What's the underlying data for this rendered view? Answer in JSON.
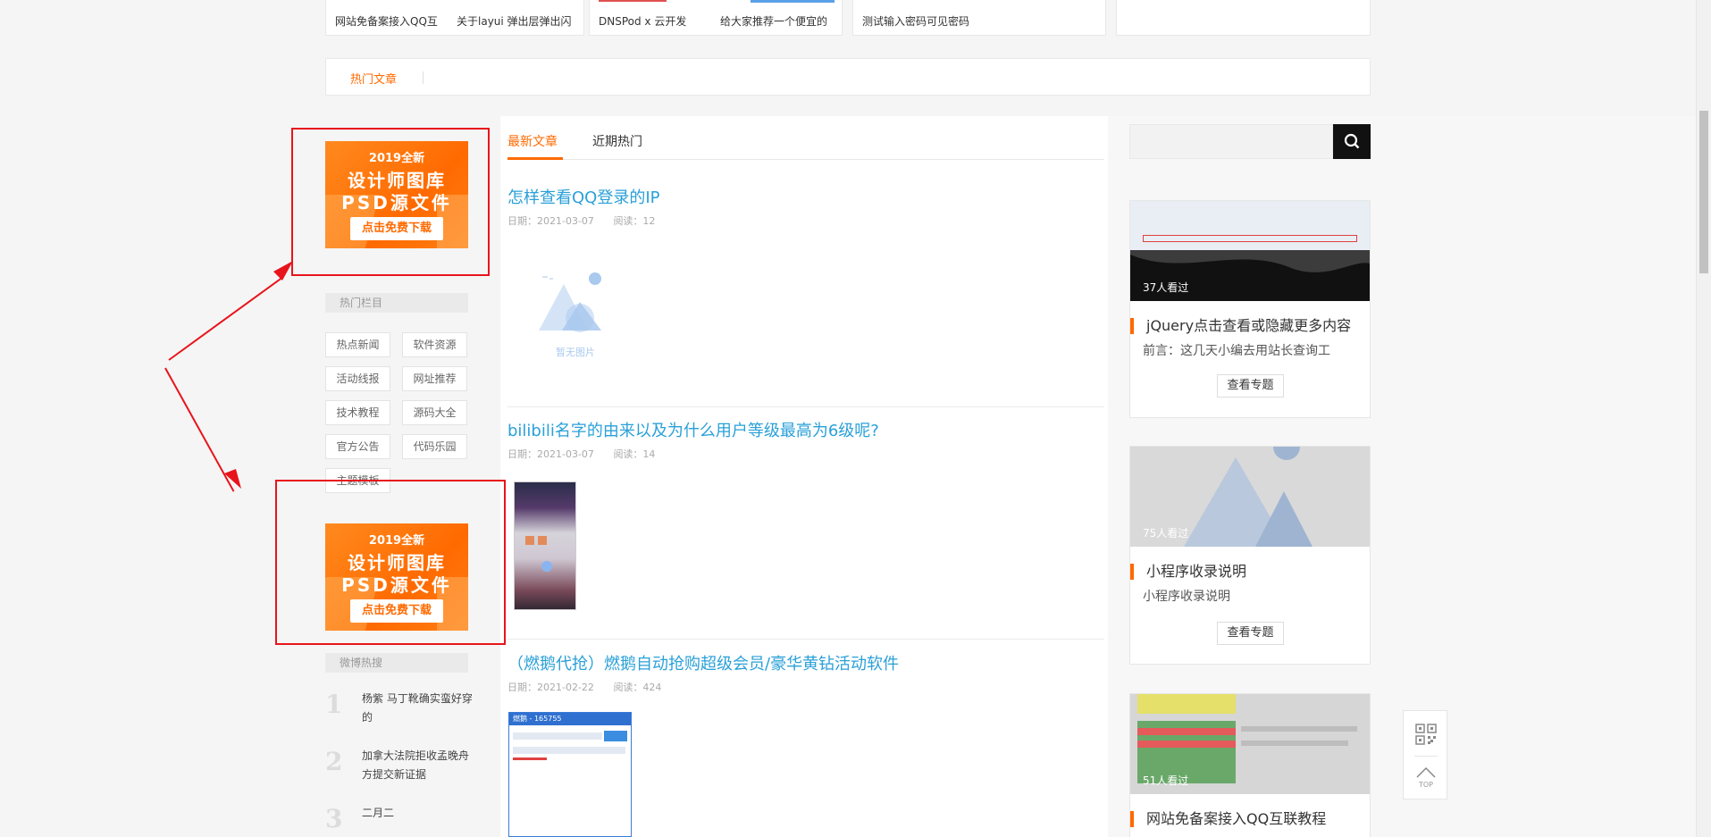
{
  "top_cards": [
    {
      "items": [
        "网站免备案接入QQ互",
        "关于layui 弹出层弹出闪"
      ]
    },
    {
      "items": [
        "DNSPod x 云开发",
        "给大家推荐一个便宜的"
      ]
    },
    {
      "items": [
        "测试输入密码可见密码"
      ]
    },
    {
      "items": []
    }
  ],
  "hot_tab": {
    "label": "热门文章"
  },
  "banner": {
    "line1": "2019全新",
    "line2": "设计师图库",
    "line3": "PSD源文件",
    "button": "点击免费下载"
  },
  "sidebar": {
    "hot_columns_title": "热门栏目",
    "categories": [
      "热点新闻",
      "软件资源",
      "活动线报",
      "网址推荐",
      "技术教程",
      "源码大全",
      "官方公告",
      "代码乐园",
      "主题模板"
    ],
    "weibo_title": "微博热搜",
    "weibo": [
      {
        "num": "1",
        "text": "杨紫 马丁靴确实蛮好穿的"
      },
      {
        "num": "2",
        "text": "加拿大法院拒收孟晚舟方提交新证据"
      },
      {
        "num": "3",
        "text": "二月二"
      }
    ]
  },
  "main": {
    "tabs": [
      "最新文章",
      "近期热门"
    ],
    "no_image_label": "暂无图片",
    "posts": [
      {
        "title": "怎样查看QQ登录的IP",
        "date": "日期：2021-03-07",
        "reads": "阅读：12"
      },
      {
        "title": "bilibili名字的由来以及为什么用户等级最高为6级呢?",
        "date": "日期：2021-03-07",
        "reads": "阅读：14"
      },
      {
        "title": "（燃鹅代抢）燃鹅自动抢购超级会员/豪华黄钻活动软件",
        "date": "日期：2021-02-22",
        "reads": "阅读：424"
      }
    ],
    "thumb2_bar": "燃鹅 - 165755"
  },
  "right": {
    "topics": [
      {
        "views": "37人看过",
        "title": "jQuery点击查看或隐藏更多内容",
        "desc": "前言：这几天小编去用站长查询工",
        "button": "查看专题"
      },
      {
        "views": "75人看过",
        "title": "小程序收录说明",
        "desc": "小程序收录说明",
        "button": "查看专题"
      },
      {
        "views": "51人看过",
        "title": "网站免备案接入QQ互联教程",
        "desc": "",
        "button": ""
      }
    ]
  },
  "float_bar": {
    "top_label": "TOP"
  },
  "colors": {
    "accent": "#ff6a00",
    "link": "#2aa0d8",
    "annotation": "#e8141b"
  }
}
